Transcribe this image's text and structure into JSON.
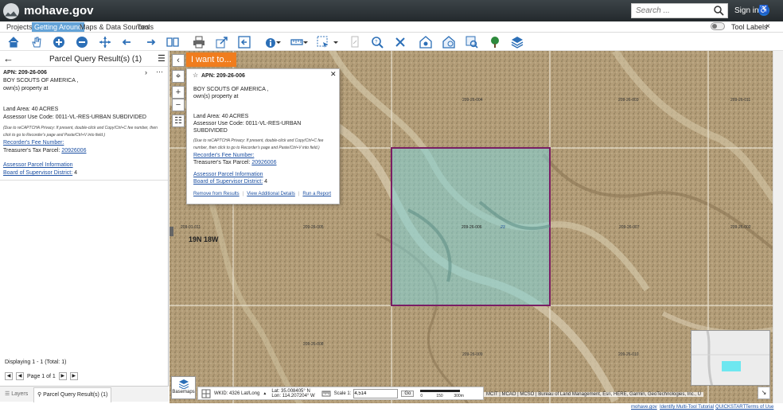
{
  "app": {
    "logo_text": "mohave.gov"
  },
  "header": {
    "search_placeholder": "Search ...",
    "signin": "Sign in",
    "access_icon": "accessibility-icon"
  },
  "menu": {
    "items": [
      "Projects",
      "Getting Around",
      "Maps & Data Sources",
      "Tools"
    ],
    "active": "Getting Around",
    "tool_labels": "Tool Labels",
    "close": "×"
  },
  "panel": {
    "title": "Parcel Query Result(s) (1)",
    "result": {
      "apn": "APN: 209-26-006",
      "owner": "BOY SCOUTS OF AMERICA ,",
      "owner_line2": "own(s) property at",
      "land_area": "Land Area: 40 ACRES",
      "use_code": "Assessor Use Code: 0011-VL-RES-URBAN SUBDIVIDED",
      "note": "(Due to reCAPTCHA Privacy: If present, double-click and Copy/Ctrl+C fee number, then click to go to Recorder's page and Paste/Ctrl+V into field.)",
      "recorder_fee": "Recorder's Fee Number:",
      "treasurer_label": "Treasurer's Tax Parcel:",
      "treasurer_value": "20926006",
      "assessor_info": "Assessor Parcel Information",
      "board_label": "Board of Supervisor District:",
      "board_value": "4"
    },
    "footer": {
      "displaying": "Displaying 1 - 1 (Total: 1)",
      "page": "Page 1 of 1"
    },
    "tabs": [
      "Layers",
      "Parcel Query Result(s) (1)"
    ]
  },
  "map": {
    "i_want_to": "I want to...",
    "township": "19N 18W",
    "selected_parcel_label": "209-26-006",
    "selected_parcel_number": "23",
    "parcel_labels": [
      "209-26-005",
      "209-26-004",
      "209-26-003",
      "209-26-007",
      "209-26-008",
      "209-26-009",
      "209-26-010",
      "209-26-011",
      "209-01-011",
      "209-26-002"
    ],
    "popup": {
      "apn": "APN: 209-26-006",
      "owner": "BOY SCOUTS OF AMERICA ,",
      "owner_line2": "own(s) property at",
      "land_area": "Land Area: 40 ACRES",
      "use_code": "Assessor Use Code: 0011-VL-RES-URBAN SUBDIVIDED",
      "note": "(Due to reCAPTCHA Privacy: If present, double-click and Copy/Ctrl+C fee number, then click to go to Recorder's page and Paste/Ctrl+V into field.)",
      "recorder_fee": "Recorder's Fee Number:",
      "treasurer_label": "Treasurer's Tax Parcel:",
      "treasurer_value": "20926006",
      "assessor_info": "Assessor Parcel Information",
      "board_label": "Board of Supervisor District:",
      "board_value": "4",
      "link_remove": "Remove from Results",
      "link_details": "View Additional Details",
      "link_report": "Run a Report"
    },
    "basemaps": "Basemaps",
    "coords": {
      "wkid": "WKID: 4326 Lat/Long",
      "lat_label": "Lat:",
      "lat": "35.008405° N",
      "lon_label": "Lon:",
      "lon": "114.207204° W"
    },
    "scale_label": "Scale 1:",
    "scale_value": "4,514",
    "go": "Go",
    "scalebar": [
      "0",
      "150",
      "300m"
    ],
    "attribution": "MCIT | MCAO | MCSO | Bureau of Land Management, Esri, HERE, Garmin, GeoTechnologies, Inc., U"
  },
  "footer_links": [
    "mohave.gov",
    "Identify Multi-Tool Tutorial",
    "QUICKSTART",
    "Terms of Use"
  ],
  "colors": {
    "accent": "#f07d1e",
    "selection_fill": "#7fd3d8",
    "selection_border": "#7a1e64",
    "link": "#1b4fa2"
  }
}
